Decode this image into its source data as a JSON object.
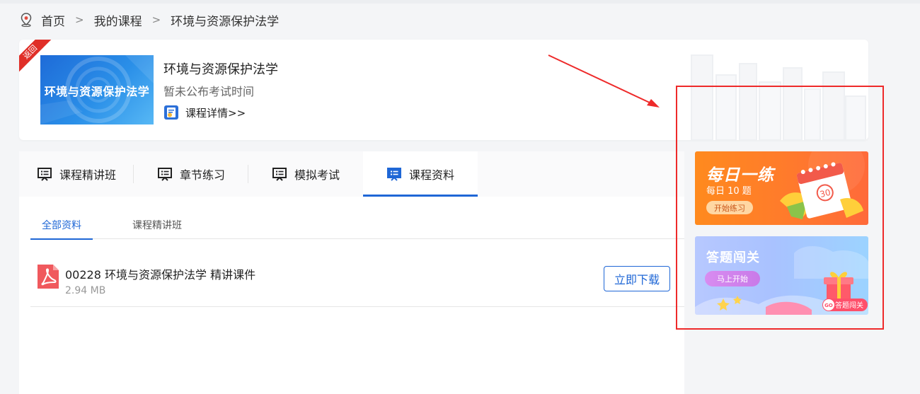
{
  "breadcrumb": {
    "home": "首页",
    "sep1": ">",
    "my_courses": "我的课程",
    "sep2": ">",
    "current": "环境与资源保护法学"
  },
  "course": {
    "ribbon_label": "返回",
    "cover_title": "环境与资源保护法学",
    "name": "环境与资源保护法学",
    "exam_time": "暂未公布考试时间",
    "detail_link": "课程详情>>"
  },
  "tabs": [
    {
      "label": "课程精讲班",
      "active": false
    },
    {
      "label": "章节练习",
      "active": false
    },
    {
      "label": "模拟考试",
      "active": false
    },
    {
      "label": "课程资料",
      "active": true
    }
  ],
  "subtabs": [
    {
      "label": "全部资料",
      "active": true
    },
    {
      "label": "课程精讲班",
      "active": false
    }
  ],
  "files": [
    {
      "name": "00228 环境与资源保护法学 精讲课件",
      "size": "2.94 MB",
      "action": "立即下载"
    }
  ],
  "banners": {
    "daily": {
      "title": "每日一练",
      "subtitle": "每日 10 题",
      "button": "开始练习",
      "calendar_number": "30"
    },
    "quiz": {
      "title": "答题闯关",
      "button": "马上开始",
      "badge": "答题闯关",
      "badge_go": "GO"
    }
  },
  "colors": {
    "accent": "#1f67d6",
    "annotation": "#ee2a2a",
    "daily_banner": "#ff7a2c",
    "quiz_banner": "#a9c2ff"
  }
}
